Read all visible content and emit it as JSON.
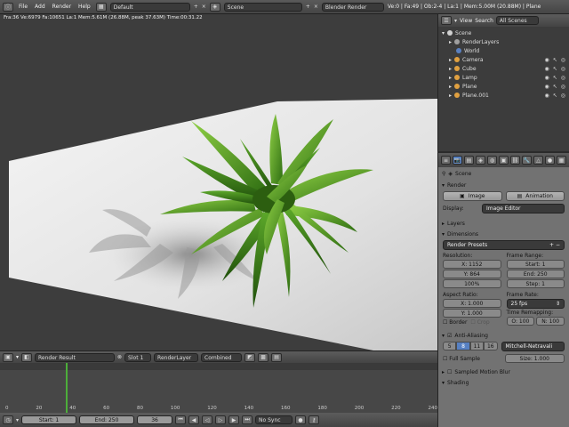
{
  "topbar": {
    "menus": [
      "File",
      "Add",
      "Render",
      "Help"
    ],
    "layout": "Default",
    "scene": "Scene",
    "engine": "Blender Render",
    "info": "Ve:0 | Fa:49 | Ob:2-4 | La:1 | Mem:5.00M (20.88M) | Plane"
  },
  "viewport": {
    "stats": "Fra:36  Ve:6979 Fa:10651 La:1 Mem:5.61M (26.88M, peak 37.63M) Time:00:31.22"
  },
  "image_editor_header": {
    "image": "Render Result",
    "slot": "Slot 1",
    "layer": "RenderLayer",
    "pass": "Combined"
  },
  "timeline": {
    "ticks": [
      "0",
      "20",
      "40",
      "60",
      "80",
      "100",
      "120",
      "140",
      "160",
      "180",
      "200",
      "220",
      "240"
    ],
    "start_label": "Start: 1",
    "end_label": "End: 250",
    "current": "36",
    "sync": "No Sync"
  },
  "outliner": {
    "view_menu": "View",
    "search_menu": "Search",
    "filter": "All Scenes",
    "items": [
      {
        "name": "Scene",
        "color": "#d0d0d0"
      },
      {
        "name": "RenderLayers",
        "color": "#a0a0a0"
      },
      {
        "name": "World",
        "color": "#5a80c0"
      },
      {
        "name": "Camera",
        "color": "#e0a040"
      },
      {
        "name": "Cube",
        "color": "#e0a040"
      },
      {
        "name": "Lamp",
        "color": "#e0a040"
      },
      {
        "name": "Plane",
        "color": "#e0a040"
      },
      {
        "name": "Plane.001",
        "color": "#e0a040"
      }
    ]
  },
  "properties": {
    "context": "Scene",
    "render": {
      "title": "Render",
      "image_btn": "Image",
      "animation_btn": "Animation",
      "display_label": "Display:",
      "display_value": "Image Editor"
    },
    "layers_title": "Layers",
    "dimensions": {
      "title": "Dimensions",
      "preset": "Render Presets",
      "resolution_label": "Resolution:",
      "res_x": "X: 1152",
      "res_y": "Y: 864",
      "res_pct": "100%",
      "frame_range_label": "Frame Range:",
      "start": "Start: 1",
      "end": "End: 250",
      "step": "Step: 1",
      "aspect_label": "Aspect Ratio:",
      "aspect_x": "X: 1.000",
      "aspect_y": "Y: 1.000",
      "frame_rate_label": "Frame Rate:",
      "fps": "25 fps",
      "time_remap_label": "Time Remapping:",
      "remap_old": "O: 100",
      "remap_new": "N: 100",
      "border": "Border",
      "crop": "Crop"
    },
    "aa": {
      "title": "Anti-Aliasing",
      "samples": [
        "5",
        "8",
        "11",
        "16"
      ],
      "filter": "Mitchell-Netravali",
      "full_sample": "Full Sample",
      "size": "Size: 1.000"
    },
    "motion_blur_title": "Sampled Motion Blur",
    "shading_title": "Shading"
  },
  "colors": {
    "accent": "#5680c2"
  }
}
